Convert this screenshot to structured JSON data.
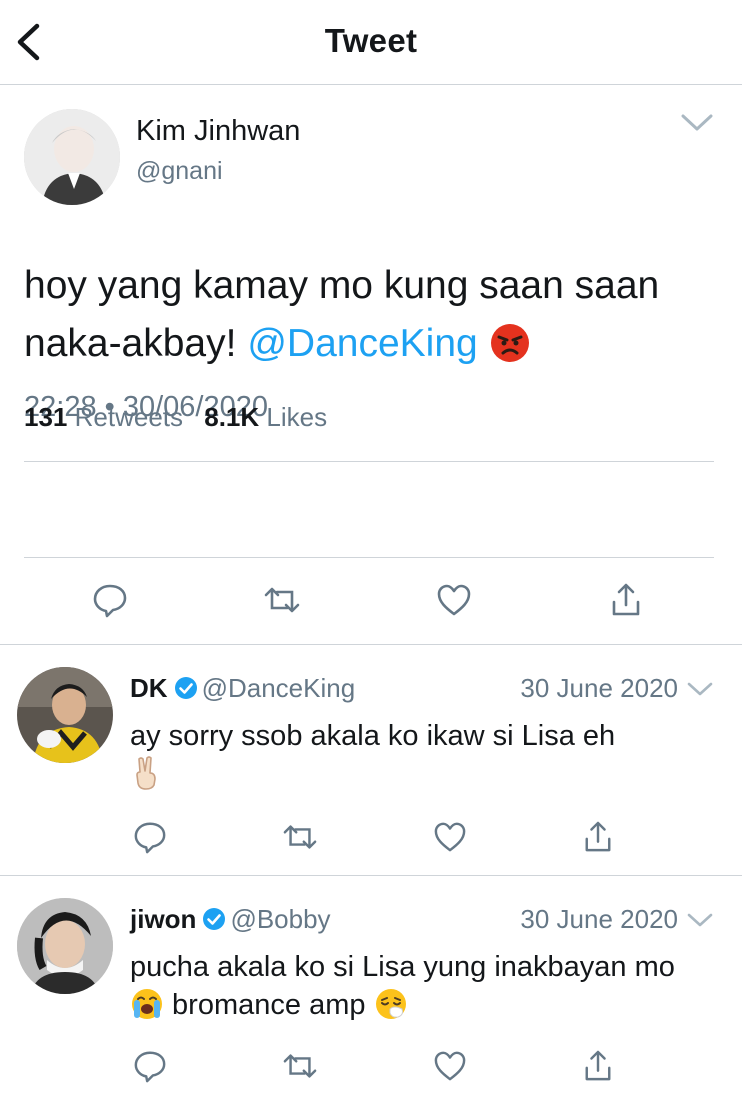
{
  "header": {
    "title": "Tweet"
  },
  "tweet": {
    "author_name": "Kim Jinhwan",
    "author_handle": "@gnani",
    "text_before": "hoy yang kamay mo kung saan saan naka-akbay! ",
    "mention": "@DanceKing",
    "emoji": "angry-face",
    "timestamp": "22:28 • 30/06/2020",
    "retweets_count": "131",
    "retweets_label": "Retweets",
    "likes_count": "8.1K",
    "likes_label": "Likes"
  },
  "replies": [
    {
      "name": "DK",
      "handle": "@DanceKing",
      "date": "30 June 2020",
      "verified": true,
      "text": "ay sorry ssob akala ko ikaw si Lisa eh",
      "emoji": "victory-hand"
    },
    {
      "name": "jiwon",
      "handle": "@Bobby",
      "date": "30 June 2020",
      "verified": true,
      "text_before": "pucha akala ko si Lisa yung inakbayan mo ",
      "text_after": " bromance amp ",
      "emojis": [
        "loudly-crying-face",
        "sneezing-face"
      ]
    }
  ],
  "icons": [
    "back-chevron-icon",
    "chevron-down-icon",
    "reply-icon",
    "retweet-icon",
    "like-icon",
    "share-icon",
    "verified-icon"
  ],
  "colors": {
    "accent": "#1da1f2",
    "secondary_text": "#657786",
    "divider": "#cfd4d9",
    "icon_gray": "#657786"
  }
}
